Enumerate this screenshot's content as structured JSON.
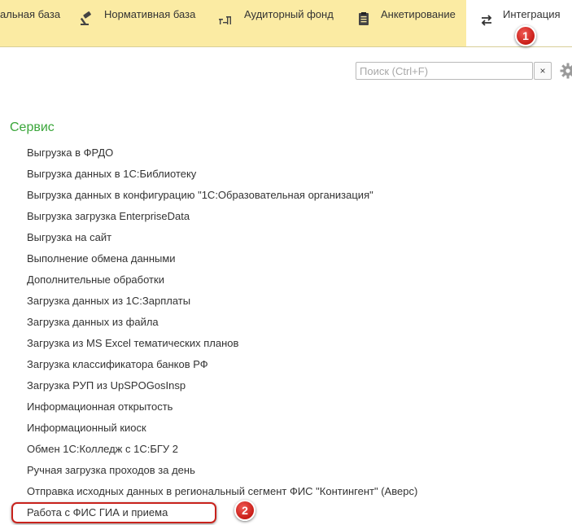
{
  "tabs": [
    {
      "label": "альная база",
      "icon": "none"
    },
    {
      "label": "Нормативная база",
      "icon": "gavel-icon"
    },
    {
      "label": "Аудиторный фонд",
      "icon": "classroom-icon"
    },
    {
      "label": "Анкетирование",
      "icon": "clipboard-icon"
    },
    {
      "label": "Интеграция",
      "icon": "exchange-arrows-icon",
      "active": true
    }
  ],
  "search": {
    "placeholder": "Поиск (Ctrl+F)",
    "value": "",
    "clear_label": "×"
  },
  "section": {
    "title": "Сервис",
    "items": [
      "Выгрузка в ФРДО",
      "Выгрузка данных в 1С:Библиотеку",
      "Выгрузка данных в конфигурацию \"1С:Образовательная организация\"",
      "Выгрузка загрузка EnterpriseData",
      "Выгрузка на сайт",
      "Выполнение обмена данными",
      "Дополнительные обработки",
      "Загрузка данных из 1С:Зарплаты",
      "Загрузка данных из файла",
      "Загрузка из MS Excel тематических планов",
      "Загрузка классификатора банков РФ",
      "Загрузка РУП из UpSPOGosInsp",
      "Информационная открытость",
      "Информационный киоск",
      "Обмен 1С:Колледж с 1С:БГУ 2",
      "Ручная загрузка проходов за день",
      "Отправка исходных данных в региональный сегмент ФИС \"Контингент\" (Аверс)",
      "Работа с ФИС ГИА и приема"
    ]
  },
  "annotations": {
    "badge1": "1",
    "badge2": "2",
    "color": "#c8221c"
  },
  "colors": {
    "tabbar": "#fbeba3",
    "section_title": "#3aa63a"
  }
}
